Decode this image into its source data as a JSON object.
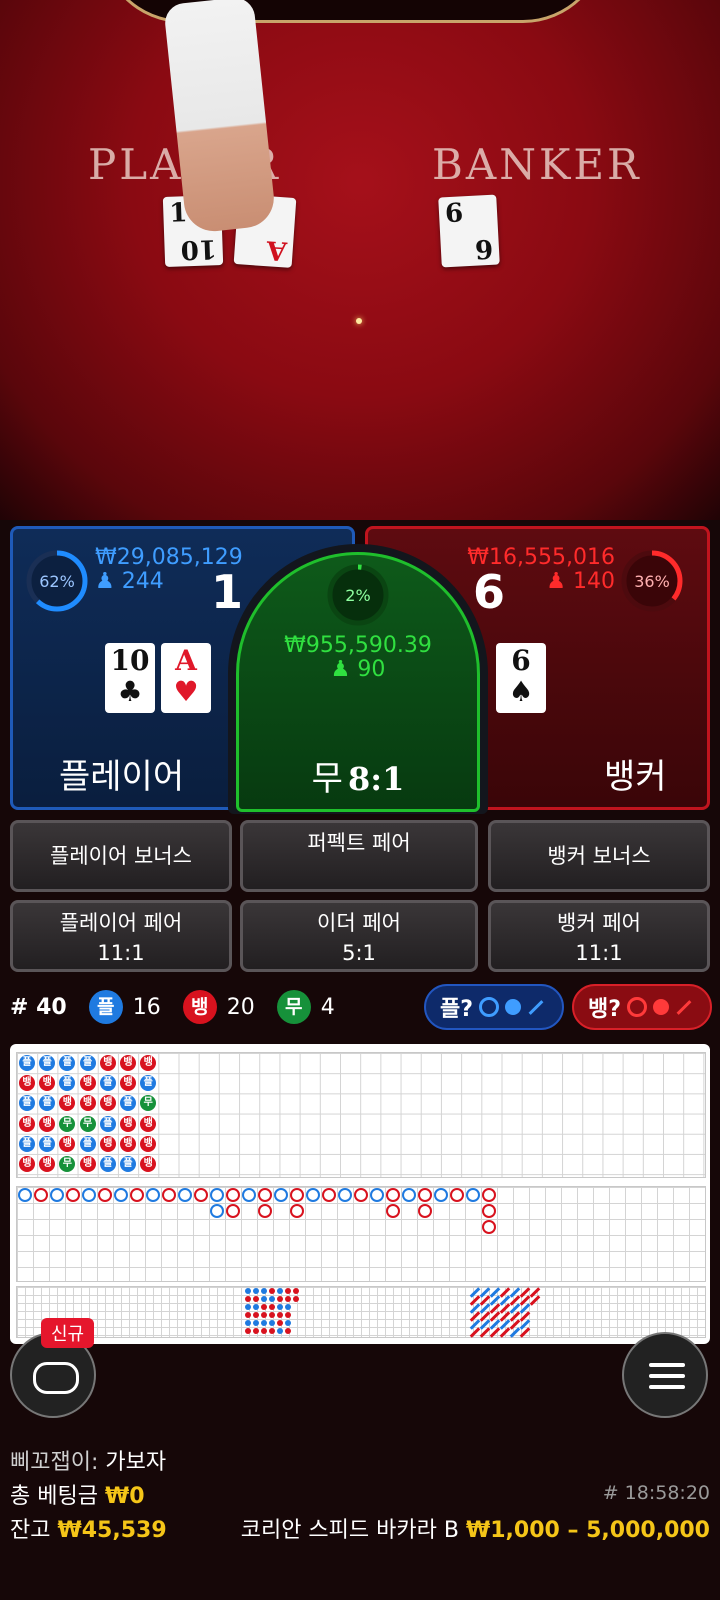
{
  "video": {
    "felt_player": "PLAYER",
    "felt_banker": "BANKER",
    "player_cards": [
      {
        "rank": "10",
        "suit": "♣",
        "red": false
      },
      {
        "rank": "A",
        "suit": "♥",
        "red": true
      }
    ],
    "banker_cards": [
      {
        "rank": "6",
        "suit": "♠",
        "red": false
      }
    ]
  },
  "player": {
    "percent": 62,
    "percent_label": "62%",
    "amount": "₩29,085,129",
    "players": "244",
    "score": "1",
    "cards": [
      {
        "rank": "10",
        "suit": "♣",
        "red": false
      },
      {
        "rank": "A",
        "suit": "♥",
        "red": true
      }
    ],
    "name": "플레이어",
    "color": "#1f8cff"
  },
  "tie": {
    "percent": 2,
    "percent_label": "2%",
    "amount": "₩955,590.39",
    "players": "90",
    "name": "무",
    "odds": "8:1",
    "color": "#30e040"
  },
  "banker": {
    "percent": 36,
    "percent_label": "36%",
    "amount": "₩16,555,016",
    "players": "140",
    "score": "6",
    "cards": [
      {
        "rank": "6",
        "suit": "♠",
        "red": false
      }
    ],
    "name": "뱅커",
    "color": "#ff2b2b"
  },
  "sidebets": {
    "player_bonus": "플레이어 보너스",
    "perfect_pair": "퍼펙트 페어",
    "banker_bonus": "뱅커 보너스",
    "player_pair": "플레이어 페어",
    "player_pair_odds": "11:1",
    "either_pair": "이더 페어",
    "either_pair_odds": "5:1",
    "banker_pair": "뱅커 페어",
    "banker_pair_odds": "11:1"
  },
  "stats": {
    "round": "# 40",
    "player_label": "플",
    "player_count": "16",
    "banker_label": "뱅",
    "banker_count": "20",
    "tie_label": "무",
    "tie_count": "4",
    "ask_player": "플?",
    "ask_banker": "뱅?"
  },
  "bead_road": [
    [
      "P",
      "B",
      "P",
      "B",
      "P",
      "B"
    ],
    [
      "P",
      "B",
      "P",
      "B",
      "P",
      "B"
    ],
    [
      "P",
      "P",
      "B",
      "T",
      "B",
      "T"
    ],
    [
      "P",
      "B",
      "B",
      "T",
      "P",
      "B"
    ],
    [
      "B",
      "P",
      "B",
      "P",
      "B",
      "P"
    ],
    [
      "B",
      "B",
      "P",
      "B",
      "B",
      "P"
    ],
    [
      "B",
      "P",
      "T",
      "B",
      "B",
      "B"
    ]
  ],
  "icons": {
    "chat": "chat-bubble-icon",
    "menu": "hamburger-menu-icon",
    "user": "user-icon"
  },
  "new_badge": "신규",
  "footer": {
    "nickname_label": "삐꼬잽이:",
    "nickname_value": "가보자",
    "total_bet_label": "총 베팅금",
    "total_bet_value": "₩0",
    "balance_label": "잔고",
    "balance_value": "₩45,539",
    "time": "# 18:58:20",
    "table_name": "코리안 스피드 바카라 B",
    "limits": "₩1,000 – 5,000,000"
  }
}
